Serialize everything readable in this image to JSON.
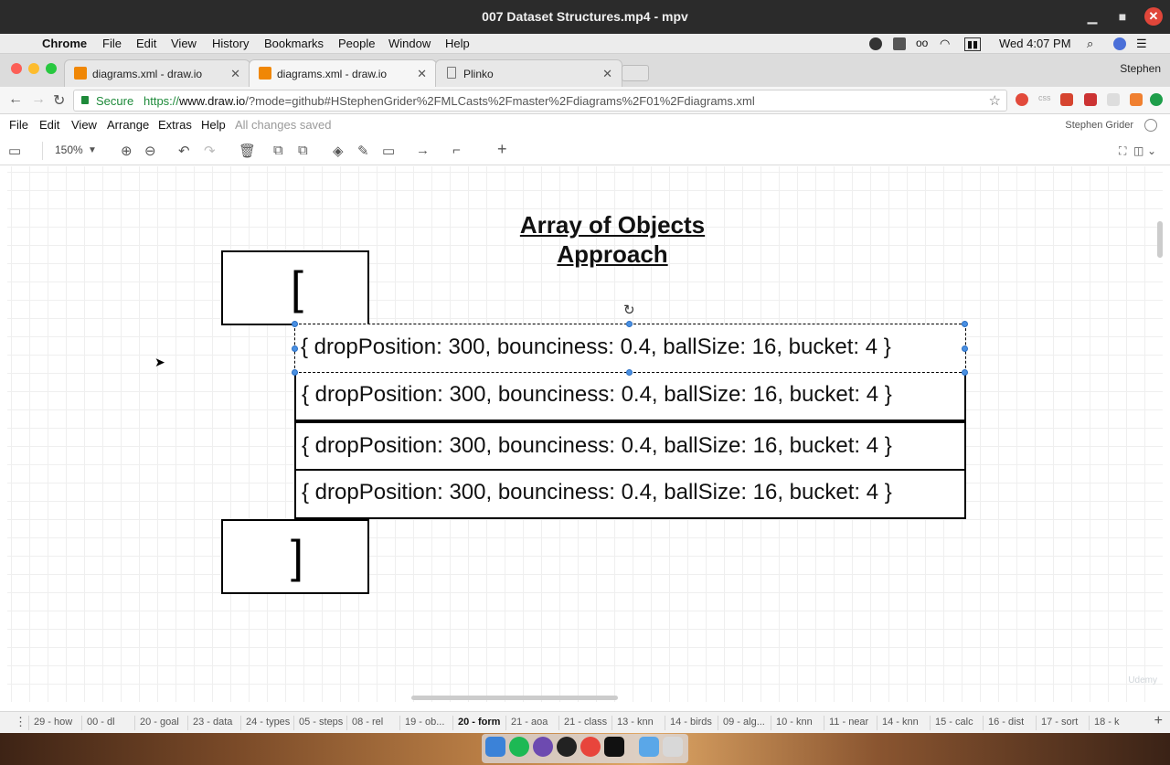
{
  "window": {
    "title": "007 Dataset Structures.mp4 - mpv"
  },
  "mac_menu": {
    "app": "Chrome",
    "items": [
      "File",
      "Edit",
      "View",
      "History",
      "Bookmarks",
      "People",
      "Window",
      "Help"
    ],
    "clock": "Wed 4:07 PM"
  },
  "browser": {
    "tabs": [
      {
        "label": "diagrams.xml - draw.io",
        "icon": "drawio-icon",
        "active": false
      },
      {
        "label": "diagrams.xml - draw.io",
        "icon": "drawio-icon",
        "active": true
      },
      {
        "label": "Plinko",
        "icon": "document-icon",
        "active": false
      }
    ],
    "profile": "Stephen",
    "secure_label": "Secure",
    "url_prefix": "https://",
    "url_host": "www.draw.io",
    "url_rest": "/?mode=github#HStephenGrider%2FMLCasts%2Fmaster%2Fdiagrams%2F01%2Fdiagrams.xml"
  },
  "drawio": {
    "menu": [
      "File",
      "Edit",
      "View",
      "Arrange",
      "Extras",
      "Help"
    ],
    "status": "All changes saved",
    "user": "Stephen Grider",
    "zoom": "150%"
  },
  "diagram": {
    "title_line1": "Array of Objects",
    "title_line2": "Approach",
    "open_bracket": "[",
    "close_bracket": "]",
    "rows": [
      "{ dropPosition: 300, bounciness: 0.4, ballSize: 16, bucket: 4 }",
      "{ dropPosition: 300, bounciness: 0.4, ballSize: 16, bucket: 4 }",
      "{ dropPosition: 300, bounciness: 0.4, ballSize: 16, bucket: 4 }",
      "{ dropPosition: 300, bounciness: 0.4, ballSize: 16, bucket: 4 }"
    ],
    "watermark": "Udemy"
  },
  "page_tabs": [
    "29 - how",
    "00 - dl",
    "20 - goal",
    "23 - data",
    "24 - types",
    "05 - steps",
    "08 - rel",
    "19 - ob...",
    "20 - form",
    "21 - aoa",
    "21 - class",
    "13 - knn",
    "14 - birds",
    "09 - alg...",
    "10 - knn",
    "11 - near",
    "14 - knn",
    "15 - calc",
    "16 - dist",
    "17 - sort",
    "18 - k"
  ],
  "active_page": "20 - form",
  "colors": {
    "drawio_orange": "#f08705",
    "selection_blue": "#4a90e2",
    "secure_green": "#1e8a3a"
  }
}
